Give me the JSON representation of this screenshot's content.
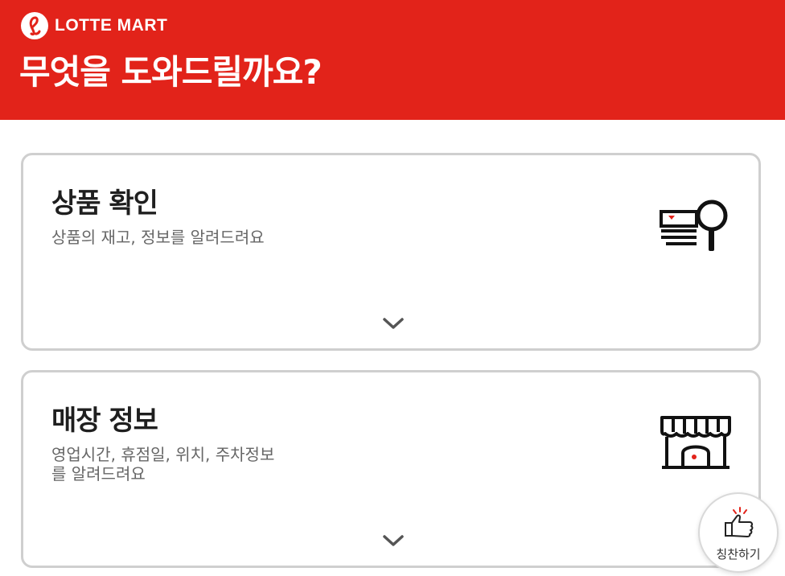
{
  "brand": {
    "name": "LOTTE MART",
    "color": "#e2231a"
  },
  "header": {
    "title": "무엇을 도와드릴까요?"
  },
  "cards": [
    {
      "title": "상품 확인",
      "description": "상품의 재고, 정보를 알려드려요",
      "icon": "product-search-icon"
    },
    {
      "title": "매장 정보",
      "description_line1": "영업시간, 휴점일, 위치, 주차정보",
      "description_line2": "를 알려드려요",
      "icon": "store-icon"
    }
  ],
  "floating_button": {
    "label": "칭찬하기",
    "icon": "thumbs-up-icon"
  }
}
